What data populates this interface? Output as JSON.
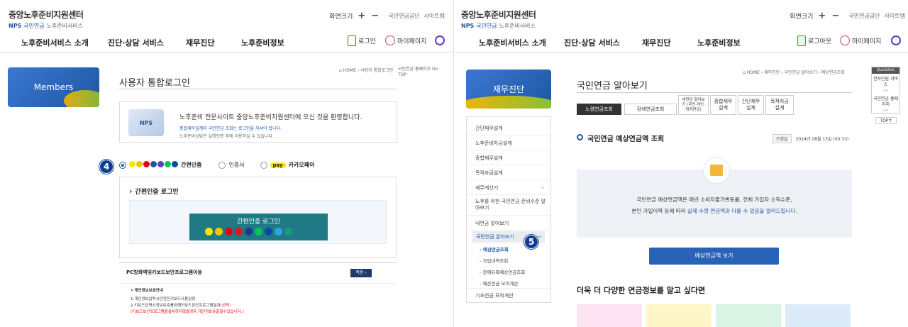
{
  "left": {
    "logo_title": "중앙노후준비지원센터",
    "logo_nps": "NPS",
    "logo_sub1": "국민연금",
    "logo_sub2": "노후준비서비스",
    "zoom_label": "화면크기",
    "zoom_in": "+",
    "zoom_out": "−",
    "util_links": [
      "국민연금공단",
      "사이트맵"
    ],
    "menu": [
      "노후준비서비스 소개",
      "진단·상담 서비스",
      "재무진단",
      "노후준비정보"
    ],
    "login": "로그인",
    "mypage": "마이페이지",
    "side_banner": "Members",
    "page_title": "사용자 통합로그인",
    "breadcrumb": "⌂ HOME › 사용자 통합로그인",
    "breadcrumb_extra": "국민연금 홈페이지 Go TOP",
    "welcome_nps": "NPS",
    "welcome_line1": "노후준비 전문사이트 중앙노후준비지원센터에 오신 것을 환영합니다.",
    "welcome_line2": "종합재무설계와 국민연금 조회는 로그인을 하셔야 합니다.",
    "welcome_line3": "노후준비상담은 실명인증 후에 이용하실 수 있습니다.",
    "radio_options": [
      "간편인증",
      "인증서",
      "카카오페이"
    ],
    "kakao_pay": "pay",
    "badge": "4",
    "easy_login_heading": "간편인증 로그인",
    "easy_login_button": "간편인증 로그인",
    "pc_security": "PC방화벽및키보드보안프로그램이용",
    "apply_button": "적용 ›",
    "notice_title": "• 개인정보보호안내",
    "notice_lines": [
      "1.개인정보입력시안전한키보드사용권장",
      "2.키보드입력시정보보호를위해키보드보안프로그램설치"
    ],
    "notice_red1": "(선택)",
    "notice_red2": "(키보드보안프로그램을설치하지않을경우,개인정보유출될수있습니다.)"
  },
  "right": {
    "logo_title": "중앙노후준비지원센터",
    "logo_nps": "NPS",
    "logo_sub1": "국민연금",
    "logo_sub2": "노후준비서비스",
    "zoom_label": "화면크기",
    "zoom_in": "+",
    "zoom_out": "−",
    "util_links": [
      "국민연금공단",
      "사이트맵"
    ],
    "menu": [
      "노후준비서비스 소개",
      "진단·상담 서비스",
      "재무진단",
      "노후준비정보"
    ],
    "logout": "로그아웃",
    "mypage": "마이페이지",
    "side_banner": "재무진단",
    "lnb_items": [
      "간단재무설계",
      "노후준비자금설계",
      "종합재무설계",
      "목적자금설계",
      "재무계산기",
      "노후를 위한 국민연금 준비수준 알아보기",
      "내연금 알아보기",
      "국민연금 알아보기"
    ],
    "lnb_plus": "+",
    "lnb_minus": "−",
    "lnb_sub": [
      "- 예상연금조회",
      "- 가입내역조회",
      "- 장애유족예상연금조회",
      "- 예상연금 모의계산"
    ],
    "lnb_last": "기초연금 모의계산",
    "badge": "5",
    "page_title": "국민연금 알아보기",
    "breadcrumb": "⌂ HOME › 재무진단 › 국민연금 알아보기 › 예상연금조회",
    "tabs": [
      "노령연금조회",
      "장애연금조회",
      "내연금 알아보기 (국민·개인·퇴직연금)",
      "종합재무 설계",
      "간단재무 설계",
      "목적자금 설계"
    ],
    "section_title": "국민연금 예상연금액 조회",
    "date_label": "조회일",
    "date_value": "2024년 08월 13일 (00:33)",
    "info_line1": "국민연금 예상연금액은 매년 소비자물가변동률, 전체 가입자 소득수준,",
    "info_line2_a": "본인 가입이력 등에 따라 ",
    "info_line2_b": "실제 수령 연금액과 다를 수 있음을 알려드립니다.",
    "view_button": "예상연금액 보기",
    "more_title": "더욱 더 다양한 연금정보를 알고 싶다면",
    "quick_head": "Quicklink",
    "quick_items": [
      "전자민원 서비스",
      "국민연금 홈페이지"
    ],
    "quick_go": "GO",
    "top": "TOP",
    "top_arrow": "↑"
  },
  "colors": {
    "primary": "#1e56a0",
    "banner": "#3b78d3",
    "easy_login": "#1f7a86",
    "view_button": "#2a62b8",
    "badge": "#0b3d91"
  }
}
